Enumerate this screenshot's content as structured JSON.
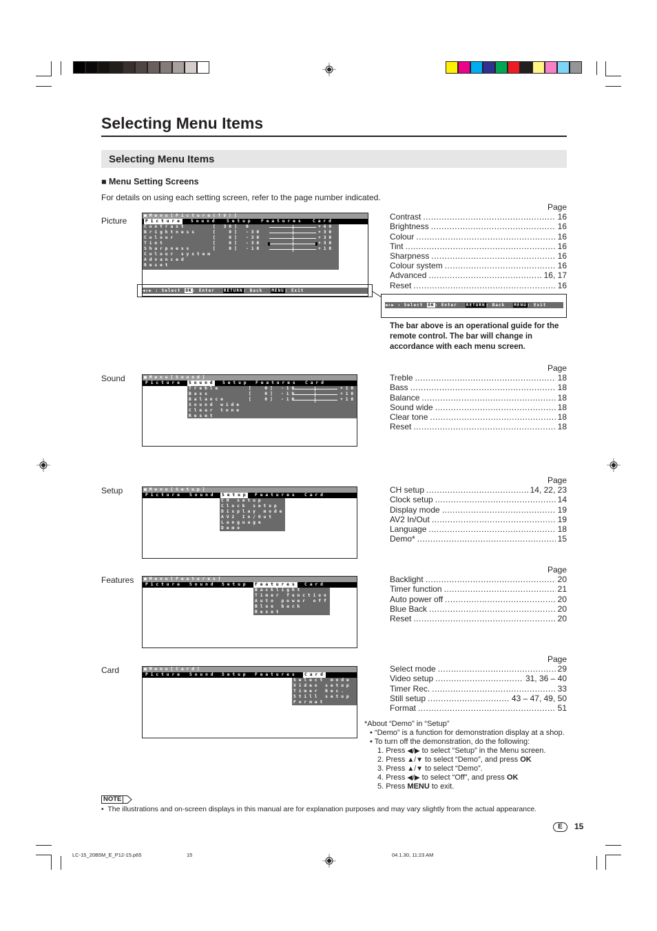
{
  "title": "Selecting Menu Items",
  "section_title": "Selecting Menu Items",
  "subsection": "■ Menu Setting Screens",
  "intro": "For details on using each setting screen, refer to the page number indicated.",
  "page_header": "Page",
  "registration_colors_left": [
    "#000000",
    "#0a0808",
    "#151210",
    "#221e1b",
    "#39302d",
    "#4f4543",
    "#6a5f5c",
    "#857b78",
    "#a8a09d",
    "#d4cdcb",
    "#ffffff"
  ],
  "registration_colors_right": [
    "#fff200",
    "#ec008c",
    "#00aeef",
    "#2e3192",
    "#00a651",
    "#ed1c24",
    "#231f20",
    "#fff685",
    "#f781c6",
    "#7dd6f7",
    "#939598"
  ],
  "guide": {
    "select": "◀⇕▶ : Select",
    "ok": "OK",
    "enter": ": Enter",
    "return": "RETURN",
    "back": ": Back",
    "menu": "MENU",
    "exit": ": Exit"
  },
  "callout_text": "The bar above is an operational guide for the remote control. The bar will change in accordance with each menu screen.",
  "tabs": [
    "Picture",
    "Sound",
    "Setup",
    "Features",
    "Card"
  ],
  "screens": [
    {
      "label": "Picture",
      "title": "■Menu[Picture(TV)]",
      "selected": 0,
      "items": [
        {
          "name": "Contrast",
          "value": "30",
          "min": "0",
          "max": "+60"
        },
        {
          "name": "Brightness",
          "value": "0",
          "min": "-30",
          "max": "+30"
        },
        {
          "name": "Colour",
          "value": "0",
          "min": "-30",
          "max": "+30"
        },
        {
          "name": "Tint",
          "value": "0",
          "min": "-30",
          "max": "+30"
        },
        {
          "name": "Sharpness",
          "value": "0",
          "min": "-10",
          "max": "+10"
        },
        {
          "name": "Colour system"
        },
        {
          "name": "Advanced"
        },
        {
          "name": "Reset"
        }
      ],
      "pages": [
        [
          "Contrast",
          "16"
        ],
        [
          "Brightness",
          "16"
        ],
        [
          "Colour",
          "16"
        ],
        [
          "Tint",
          "16"
        ],
        [
          "Sharpness",
          "16"
        ],
        [
          "Colour system",
          "16"
        ],
        [
          "Advanced",
          "16, 17"
        ],
        [
          "Reset",
          "16"
        ]
      ]
    },
    {
      "label": "Sound",
      "title": "■Menu[Sound]",
      "selected": 1,
      "items": [
        {
          "name": "Treble",
          "value": "0",
          "min": "-10",
          "max": "+10"
        },
        {
          "name": "Bass",
          "value": "0",
          "min": "-10",
          "max": "+10"
        },
        {
          "name": "Balance",
          "value": "0",
          "min": "-10",
          "max": "+10"
        },
        {
          "name": "Sound wide"
        },
        {
          "name": "Clear tone"
        },
        {
          "name": "Reset"
        }
      ],
      "pages": [
        [
          "Treble",
          "18"
        ],
        [
          "Bass",
          "18"
        ],
        [
          "Balance",
          "18"
        ],
        [
          "Sound wide",
          "18"
        ],
        [
          "Clear tone",
          "18"
        ],
        [
          "Reset",
          "18"
        ]
      ]
    },
    {
      "label": "Setup",
      "title": "■Menu[Setup]",
      "selected": 2,
      "items": [
        {
          "name": "CH setup"
        },
        {
          "name": "Clock setup"
        },
        {
          "name": "Display mode"
        },
        {
          "name": "AV2 In/Out"
        },
        {
          "name": "Language"
        },
        {
          "name": "Demo"
        }
      ],
      "pages": [
        [
          "CH setup",
          "14, 22, 23"
        ],
        [
          "Clock setup",
          "14"
        ],
        [
          "Display mode",
          "19"
        ],
        [
          "AV2 In/Out",
          "19"
        ],
        [
          "Language",
          "18"
        ],
        [
          "Demo*",
          "15"
        ]
      ]
    },
    {
      "label": "Features",
      "title": "■Menu[Features]",
      "selected": 3,
      "items": [
        {
          "name": "Backlight"
        },
        {
          "name": "Timer function"
        },
        {
          "name": "Auto power off"
        },
        {
          "name": "Blue back"
        },
        {
          "name": "Reset"
        }
      ],
      "pages": [
        [
          "Backlight",
          "20"
        ],
        [
          "Timer function",
          "21"
        ],
        [
          "Auto power off",
          "20"
        ],
        [
          "Blue Back",
          "20"
        ],
        [
          "Reset",
          "20"
        ]
      ]
    },
    {
      "label": "Card",
      "title": "■Menu[Card]",
      "selected": 4,
      "items": [
        {
          "name": "Select mode"
        },
        {
          "name": "Video setup"
        },
        {
          "name": "Timer Rec."
        },
        {
          "name": "Still setup"
        },
        {
          "name": "Format"
        }
      ],
      "pages": [
        [
          "Select mode",
          "29"
        ],
        [
          "Video setup",
          "31, 36 – 40"
        ],
        [
          "Timer Rec.",
          "33"
        ],
        [
          "Still setup",
          "43 – 47, 49, 50"
        ],
        [
          "Format",
          "51"
        ]
      ]
    }
  ],
  "demo": {
    "heading": "*About “Demo” in “Setup”",
    "bullet1": "“Demo” is a function for demonstration display at a shop.",
    "bullet2": "To turn off the demonstration, do the following:",
    "steps": [
      [
        "1. Press ",
        "◀/▶",
        " to select “Setup” in the Menu screen.",
        ""
      ],
      [
        "2. Press ",
        "▲/▼",
        " to select “Demo”, and press ",
        "OK"
      ],
      [
        "3. Press ",
        "▲/▼",
        " to select “Demo”.",
        ""
      ],
      [
        "4. Press ",
        "◀/▶",
        " to select “Off”, and press ",
        "OK"
      ],
      [
        "5. Press ",
        "MENU",
        " to exit.",
        ""
      ]
    ]
  },
  "note": {
    "label": "NOTE",
    "text": "The illustrations and on-screen displays in this manual are for explanation purposes and may vary slightly from the actual appearance."
  },
  "page_number": {
    "lang": "E",
    "number": "15"
  },
  "footer": {
    "file": "LC-15_20B5M_E_P12-15.p65",
    "page": "15",
    "date": "04.1.30, 11:23 AM"
  }
}
